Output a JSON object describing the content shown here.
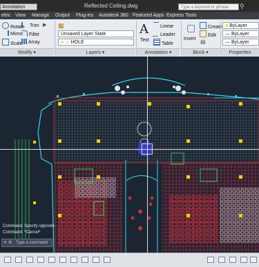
{
  "titlebar": {
    "workspace": "Annotation",
    "document": "Reflected Ceiling.dwg",
    "search_placeholder": "Type a keyword or phrase"
  },
  "tabs": [
    "etric",
    "View",
    "Manage",
    "Output",
    "Plug-ins",
    "Autodesk 360",
    "Featured Apps",
    "Express Tools"
  ],
  "modify": {
    "rotate": "Rotate",
    "trim": "Trim",
    "mirror": "Mirror",
    "fillet": "Fillet",
    "scale": "Scale",
    "array": "Array",
    "panel": "Modify"
  },
  "layers": {
    "layer_state": "Unsaved Layer State",
    "current_layer": "HOLE",
    "panel": "Layers"
  },
  "annotation": {
    "text": "Text",
    "linear": "Linear",
    "leader": "Leader",
    "table": "Table",
    "panel": "Annotation"
  },
  "block": {
    "insert": "Insert",
    "create": "Create",
    "edit": "Edit",
    "panel": "Block"
  },
  "properties": {
    "bylayer1": "ByLayer",
    "bylayer2": "ByLayer",
    "bylayer3": "ByLayer",
    "panel": "Properties"
  },
  "command": {
    "line1": "Command: Specify opposite",
    "line2": "Command: *Cancel*",
    "prompt": "Type a command"
  },
  "colors": {
    "canvas": "#1c2633",
    "cyan": "#37d6e8",
    "red": "#d6303a",
    "yellow": "#f2d500",
    "green": "#37c45a",
    "white": "#dfe5ec"
  }
}
